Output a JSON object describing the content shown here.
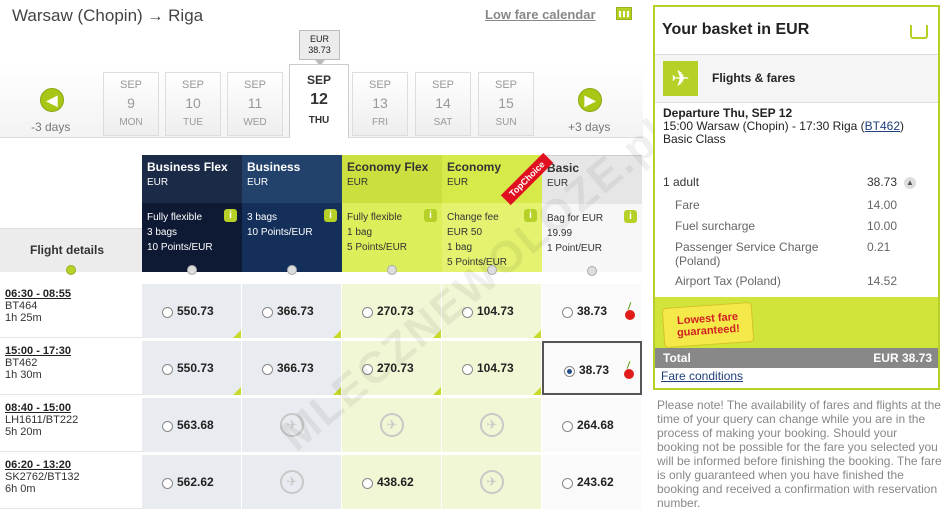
{
  "route": {
    "from": "Warsaw (Chopin)",
    "arrow": "→",
    "to": "Riga"
  },
  "low_fare_calendar": "Low fare calendar",
  "nav": {
    "prev": "-3 days",
    "next": "+3 days"
  },
  "selected_price": {
    "currency": "EUR",
    "value": "38.73"
  },
  "dates": [
    {
      "month": "SEP",
      "day": "9",
      "weekday": "MON"
    },
    {
      "month": "SEP",
      "day": "10",
      "weekday": "TUE"
    },
    {
      "month": "SEP",
      "day": "11",
      "weekday": "WED"
    },
    {
      "month": "SEP",
      "day": "12",
      "weekday": "THU",
      "selected": true
    },
    {
      "month": "SEP",
      "day": "13",
      "weekday": "FRI"
    },
    {
      "month": "SEP",
      "day": "14",
      "weekday": "SAT"
    },
    {
      "month": "SEP",
      "day": "15",
      "weekday": "SUN"
    }
  ],
  "flight_details_label": "Flight details",
  "fares": [
    {
      "name": "Business Flex",
      "currency": "EUR",
      "features": [
        "Fully flexible",
        "3 bags",
        "10 Points/EUR"
      ]
    },
    {
      "name": "Business",
      "currency": "EUR",
      "features": [
        "3 bags",
        "10 Points/EUR"
      ]
    },
    {
      "name": "Economy Flex",
      "currency": "EUR",
      "features": [
        "Fully flexible",
        "1 bag",
        "5 Points/EUR"
      ]
    },
    {
      "name": "Economy",
      "currency": "EUR",
      "badge": "TopChoice",
      "features": [
        "Change fee",
        "EUR 50",
        "1 bag",
        "5 Points/EUR"
      ]
    },
    {
      "name": "Basic",
      "currency": "EUR",
      "features": [
        "Bag for EUR",
        "19.99",
        "1 Point/EUR"
      ]
    }
  ],
  "flights": [
    {
      "time": "06:30 - 08:55",
      "flight": "BT464",
      "duration": "1h 25m",
      "prices": [
        "550.73",
        "366.73",
        "270.73",
        "104.73",
        "38.73"
      ]
    },
    {
      "time": "15:00 - 17:30",
      "flight": "BT462",
      "duration": "1h 30m",
      "prices": [
        "550.73",
        "366.73",
        "270.73",
        "104.73",
        "38.73"
      ]
    },
    {
      "time": "08:40 - 15:00",
      "flight": "LH1611/BT222",
      "duration": "5h 20m",
      "prices": [
        "563.68",
        "",
        "",
        "",
        "264.68"
      ]
    },
    {
      "time": "06:20 - 13:20",
      "flight": "SK2762/BT132",
      "duration": "6h 0m",
      "prices": [
        "562.62",
        "",
        "438.62",
        "",
        "243.62"
      ]
    }
  ],
  "basket": {
    "title": "Your basket in EUR",
    "section": "Flights & fares",
    "departure_label": "Departure Thu, SEP 12",
    "departure_detail": "15:00 Warsaw (Chopin) - 17:30 Riga (",
    "flight_code": "BT462",
    "class": "Basic Class",
    "adult_label": "1 adult",
    "adult_value": "38.73",
    "lines": [
      {
        "label": "Fare",
        "value": "14.00"
      },
      {
        "label": "Fuel surcharge",
        "value": "10.00"
      },
      {
        "label": "Passenger Service Charge (Poland)",
        "value": "0.21"
      },
      {
        "label": "Airport Tax (Poland)",
        "value": "14.52"
      }
    ],
    "lowest_fare": "Lowest fare guaranteed!",
    "total_label": "Total",
    "total_value": "EUR 38.73",
    "conditions": "Fare conditions"
  },
  "note": "Please note! The availability of fares and flights at the time of your query can change while you are in the process of making your booking. Should your booking not be possible for the fare you selected you will be informed before finishing the booking. The fare is only guaranteed when you have finished the booking and received a confirmation with reservation number.",
  "watermark": "MLECZNEWOLOZE.pl",
  "colors": {
    "brand": "#b6d028",
    "dark": "#1a2a47",
    "economy": "#cbe03f"
  }
}
